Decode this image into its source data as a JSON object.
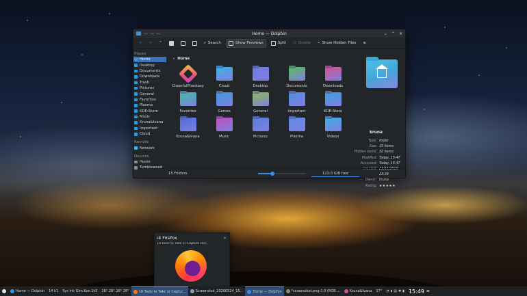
{
  "window": {
    "title": "Home — Dolphin",
    "toolbar": {
      "search": "Search",
      "show_previews": "Show Previews",
      "split": "Split",
      "delete": "Delete",
      "show_hidden": "Show Hidden Files"
    }
  },
  "sidebar": {
    "places_heading": "Places",
    "places": [
      "Home",
      "Desktop",
      "Documents",
      "Downloads",
      "Trash",
      "Pictures",
      "General",
      "Favorites",
      "Plasma",
      "KDE-Store",
      "Music",
      "Kruna&Ivana",
      "Important",
      "Cloud"
    ],
    "remote_heading": "Remote",
    "remote": [
      "Network"
    ],
    "devices_heading": "Devices",
    "devices": [
      "Home",
      "Tumbleweed"
    ]
  },
  "breadcrumb": "Home",
  "items": [
    {
      "label": "CheerfulPhantasy",
      "icon": "app-logo-icon",
      "color": "#f2c94c"
    },
    {
      "label": "Cloud",
      "icon": "cloud-folder-icon",
      "color": "#37b6e6"
    },
    {
      "label": "Desktop",
      "icon": "desktop-folder-icon",
      "color": "#6a7de0"
    },
    {
      "label": "Documents",
      "icon": "documents-folder-icon",
      "color": "#58c05a"
    },
    {
      "label": "Downloads",
      "icon": "downloads-folder-icon",
      "color": "#d8508c"
    },
    {
      "label": "Favorites",
      "icon": "favorites-folder-icon",
      "color": "#3fbf9f"
    },
    {
      "label": "Games",
      "icon": "games-folder-icon",
      "color": "#3c9be0"
    },
    {
      "label": "General",
      "icon": "general-folder-icon",
      "color": "#8fbf4a"
    },
    {
      "label": "Important",
      "icon": "important-folder-icon",
      "color": "#4f8fe0"
    },
    {
      "label": "KDE-Store",
      "icon": "kde-store-folder-icon",
      "color": "#3aa0d8"
    },
    {
      "label": "Kruna&Ivana",
      "icon": "kruna-ivana-folder-icon",
      "color": "#4c6fd8"
    },
    {
      "label": "Music",
      "icon": "music-folder-icon",
      "color": "#c04fb8"
    },
    {
      "label": "Pictures",
      "icon": "pictures-folder-icon",
      "color": "#5a7ee0"
    },
    {
      "label": "Plasma",
      "icon": "plasma-folder-icon",
      "color": "#5b8de6"
    },
    {
      "label": "Videos",
      "icon": "videos-folder-icon",
      "color": "#3db0e0"
    }
  ],
  "info": {
    "name": "kruna",
    "props": [
      {
        "k": "Type:",
        "v": "folder"
      },
      {
        "k": "Size:",
        "v": "15 items"
      },
      {
        "k": "Hidden items:",
        "v": "32 items"
      },
      {
        "k": "Modified:",
        "v": "Today, 15:47"
      },
      {
        "k": "Accessed:",
        "v": "Today, 15:47"
      },
      {
        "k": "Created:",
        "v": "21/11/2019\n23:39"
      },
      {
        "k": "Owner:",
        "v": "kruna"
      },
      {
        "k": "Rating:",
        "v": "★★★★★"
      }
    ]
  },
  "status": {
    "count": "15 Folders",
    "free": "122.0 GiB free",
    "zoom_fraction": 0.3
  },
  "firefox_popup": {
    "title": "Firefox",
    "subtitle": "10 Tools to Take or Capture Des..."
  },
  "taskbar": {
    "items": [
      "Home — Dolphin",
      "14 k1",
      "Sys Ink Gim Kon 1k5",
      "28° 28° 28° 28°",
      "10 Tools to Take or Captur...",
      "Screenshot_20200524_15...",
      "Home — Dolphin",
      "*screenshot.png-1.0 (RGB ...",
      "Kruna&Ivana",
      "17°"
    ],
    "time": "15:49"
  }
}
